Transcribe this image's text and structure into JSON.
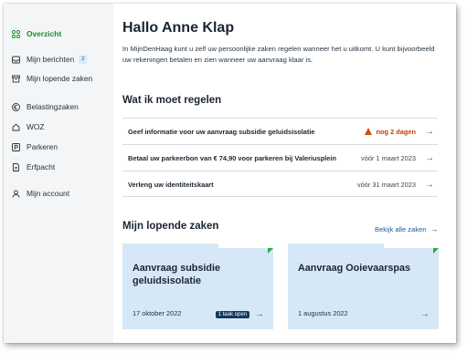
{
  "sidebar": {
    "items": [
      {
        "label": "Overzicht",
        "icon": "grid-icon"
      },
      {
        "label": "Mijn berichten",
        "icon": "inbox-icon",
        "badge": "2"
      },
      {
        "label": "Mijn lopende zaken",
        "icon": "archive-icon"
      },
      {
        "label": "Belastingzaken",
        "icon": "euro-icon"
      },
      {
        "label": "WOZ",
        "icon": "house-icon"
      },
      {
        "label": "Parkeren",
        "icon": "parking-icon"
      },
      {
        "label": "Erfpacht",
        "icon": "document-icon"
      },
      {
        "label": "Mijn account",
        "icon": "user-icon"
      }
    ]
  },
  "main": {
    "title": "Hallo Anne Klap",
    "intro": "In MijnDenHaag kunt u zelf uw persoonlijke zaken regelen wanneer het u uitkomt. U kunt bijvoorbeeld uw rekeningen betalen en zien wanneer uw aanvraag klaar is.",
    "tasks_heading": "Wat ik moet regelen",
    "tasks": [
      {
        "title": "Geef informatie voor uw aanvraag subsidie geluidsisolatie",
        "status": "nog 2 dagen"
      },
      {
        "title": "Betaal uw parkeerbon van € 74,90 voor parkeren bij Valeriusplein",
        "status": "vóór 1 maart 2023"
      },
      {
        "title": "Verleng uw identiteitskaart",
        "status": "vóór 31 maart 2023"
      }
    ],
    "cases_heading": "Mijn lopende zaken",
    "cases_link": "Bekijk alle zaken",
    "cases": [
      {
        "title": "Aanvraag subsidie geluidsisolatie",
        "date": "17 oktober 2022",
        "tag": "1 taak open"
      },
      {
        "title": "Aanvraag Ooievaarspas",
        "date": "1 augustus 2022"
      }
    ]
  },
  "colors": {
    "accent_green": "#1a8a2e",
    "link_blue": "#1d5b93",
    "card_bg": "#d6e8f7",
    "warning": "#d24b0b"
  }
}
